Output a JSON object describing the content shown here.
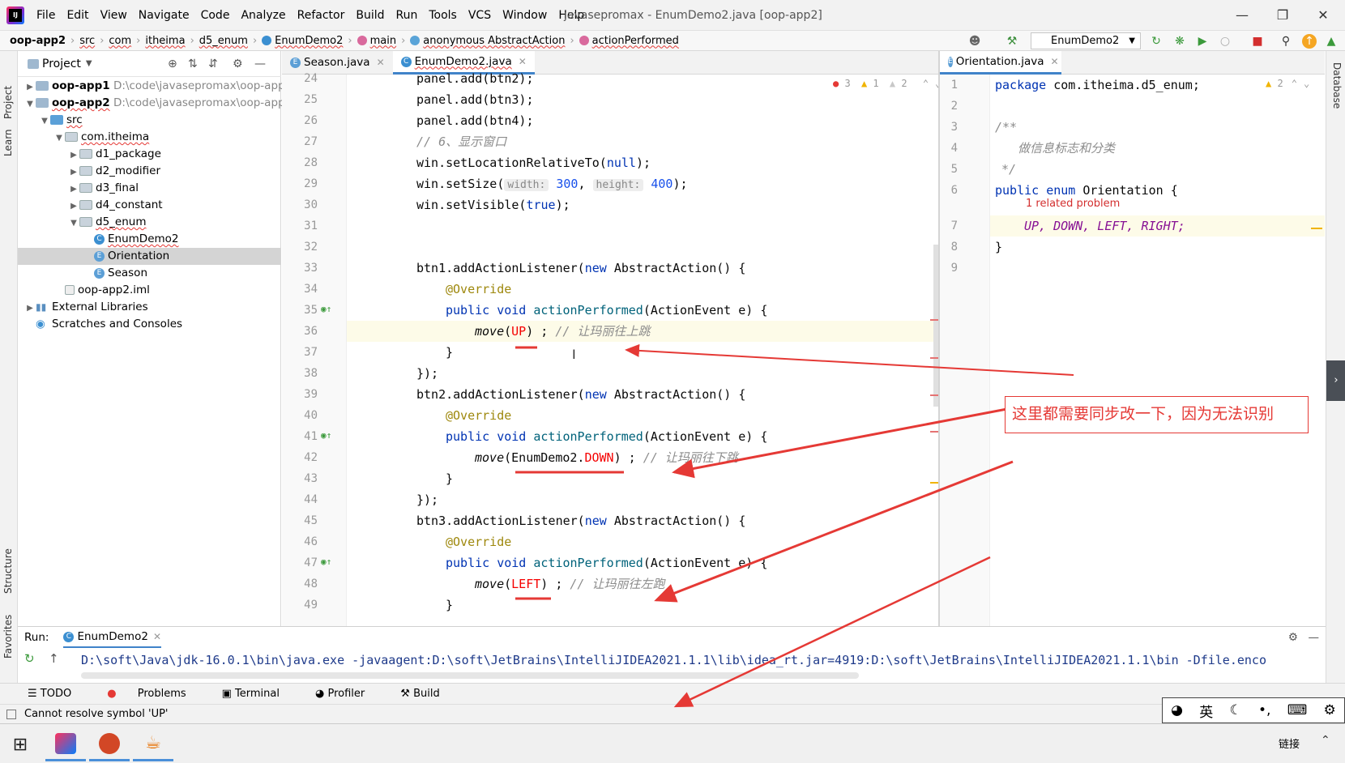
{
  "window": {
    "title": "javasepromax - EnumDemo2.java [oop-app2]",
    "menus": [
      "File",
      "Edit",
      "View",
      "Navigate",
      "Code",
      "Analyze",
      "Refactor",
      "Build",
      "Run",
      "Tools",
      "VCS",
      "Window",
      "Help"
    ]
  },
  "breadcrumb": [
    "oop-app2",
    "src",
    "com",
    "itheima",
    "d5_enum",
    "EnumDemo2",
    "main",
    "anonymous AbstractAction",
    "actionPerformed"
  ],
  "run_config": "EnumDemo2",
  "project_panel": {
    "title": "Project",
    "tree": [
      {
        "label": "oop-app1",
        "path": "D:\\code\\javasepromax\\oop-app1"
      },
      {
        "label": "oop-app2",
        "path": "D:\\code\\javasepromax\\oop-app2"
      },
      {
        "label": "src"
      },
      {
        "label": "com.itheima"
      },
      {
        "label": "d1_package"
      },
      {
        "label": "d2_modifier"
      },
      {
        "label": "d3_final"
      },
      {
        "label": "d4_constant"
      },
      {
        "label": "d5_enum"
      },
      {
        "label": "EnumDemo2"
      },
      {
        "label": "Orientation"
      },
      {
        "label": "Season"
      },
      {
        "label": "oop-app2.iml"
      },
      {
        "label": "External Libraries"
      },
      {
        "label": "Scratches and Consoles"
      }
    ]
  },
  "left_strip": {
    "project": "Project",
    "learn": "Learn",
    "structure": "Structure",
    "favorites": "Favorites"
  },
  "right_strip": {
    "database": "Database"
  },
  "editor_tabs": [
    "Season.java",
    "EnumDemo2.java"
  ],
  "editor2_tabs": [
    "Orientation.java"
  ],
  "editor1": {
    "inspection": {
      "errors": "3",
      "warnings": "1",
      "weak": "2"
    },
    "line_numbers": [
      "24",
      "25",
      "26",
      "27",
      "28",
      "29",
      "30",
      "31",
      "32",
      "33",
      "34",
      "35",
      "36",
      "37",
      "38",
      "39",
      "40",
      "41",
      "42",
      "43",
      "44",
      "45",
      "46",
      "47",
      "48",
      "49"
    ],
    "lines": {
      "l24": "panel.add(btn2);",
      "l25": "panel.add(btn3);",
      "l26": "panel.add(btn4);",
      "l27": "// 6、显示窗口",
      "l28a": "win.setLocationRelativeTo(",
      "l28b": "null",
      "l28c": ");",
      "l29a": "win.setSize(",
      "l29h1": "width:",
      "l29n1": "300",
      "l29h2": "height:",
      "l29n2": "400",
      "l29c": ");",
      "l30a": "win.setVisible(",
      "l30b": "true",
      "l30c": ");",
      "l33a": "btn1.addActionListener(",
      "l33kw": "new",
      "l33b": " AbstractAction() {",
      "override": "@Override",
      "pv": "public void",
      "ap": "actionPerformed",
      "apargs": "(ActionEvent e) {",
      "move": "move",
      "up": "UP",
      "c36": "// 让玛丽往上跳",
      "closebrace": "}",
      "closecall": "});",
      "l39a": "btn2.addActionListener(",
      "l45a": "btn3.addActionListener(",
      "enumdemo": "EnumDemo2.",
      "down": "DOWN",
      "c42": "// 让玛丽往下跳",
      "left": "LEFT",
      "c48": "// 让玛丽往左跑",
      "semi": ") ;"
    }
  },
  "editor2": {
    "warnings": "2",
    "line_numbers": [
      "1",
      "2",
      "3",
      "4",
      "5",
      "6",
      "7",
      "8",
      "9"
    ],
    "lines": {
      "pkgkw": "package",
      "pkg": " com.itheima.d5_enum;",
      "doc1": "/**",
      "doc2": "做信息标志和分类",
      "doc3": "*/",
      "pe": "public enum",
      "name": " Orientation {",
      "problem": "1 related problem",
      "values": "UP, DOWN, LEFT, RIGHT;",
      "close": "}"
    }
  },
  "run_panel": {
    "label": "Run:",
    "tab": "EnumDemo2",
    "command": "D:\\soft\\Java\\jdk-16.0.1\\bin\\java.exe -javaagent:D:\\soft\\JetBrains\\IntelliJIDEA2021.1.1\\lib\\idea_rt.jar=4919:D:\\soft\\JetBrains\\IntelliJIDEA2021.1.1\\bin -Dfile.enco"
  },
  "bottom_tools": [
    "TODO",
    "Problems",
    "Terminal",
    "Profiler",
    "Build"
  ],
  "status": "Cannot resolve symbol 'UP'",
  "ime": {
    "lang": "英"
  },
  "taskbar": {
    "tray": "链接"
  },
  "annotation": "这里都需要同步改一下，因为无法识别",
  "colors": {
    "error": "#f50000",
    "keyword": "#0033b3",
    "accent": "#4083c9",
    "annotation": "#e53935"
  }
}
